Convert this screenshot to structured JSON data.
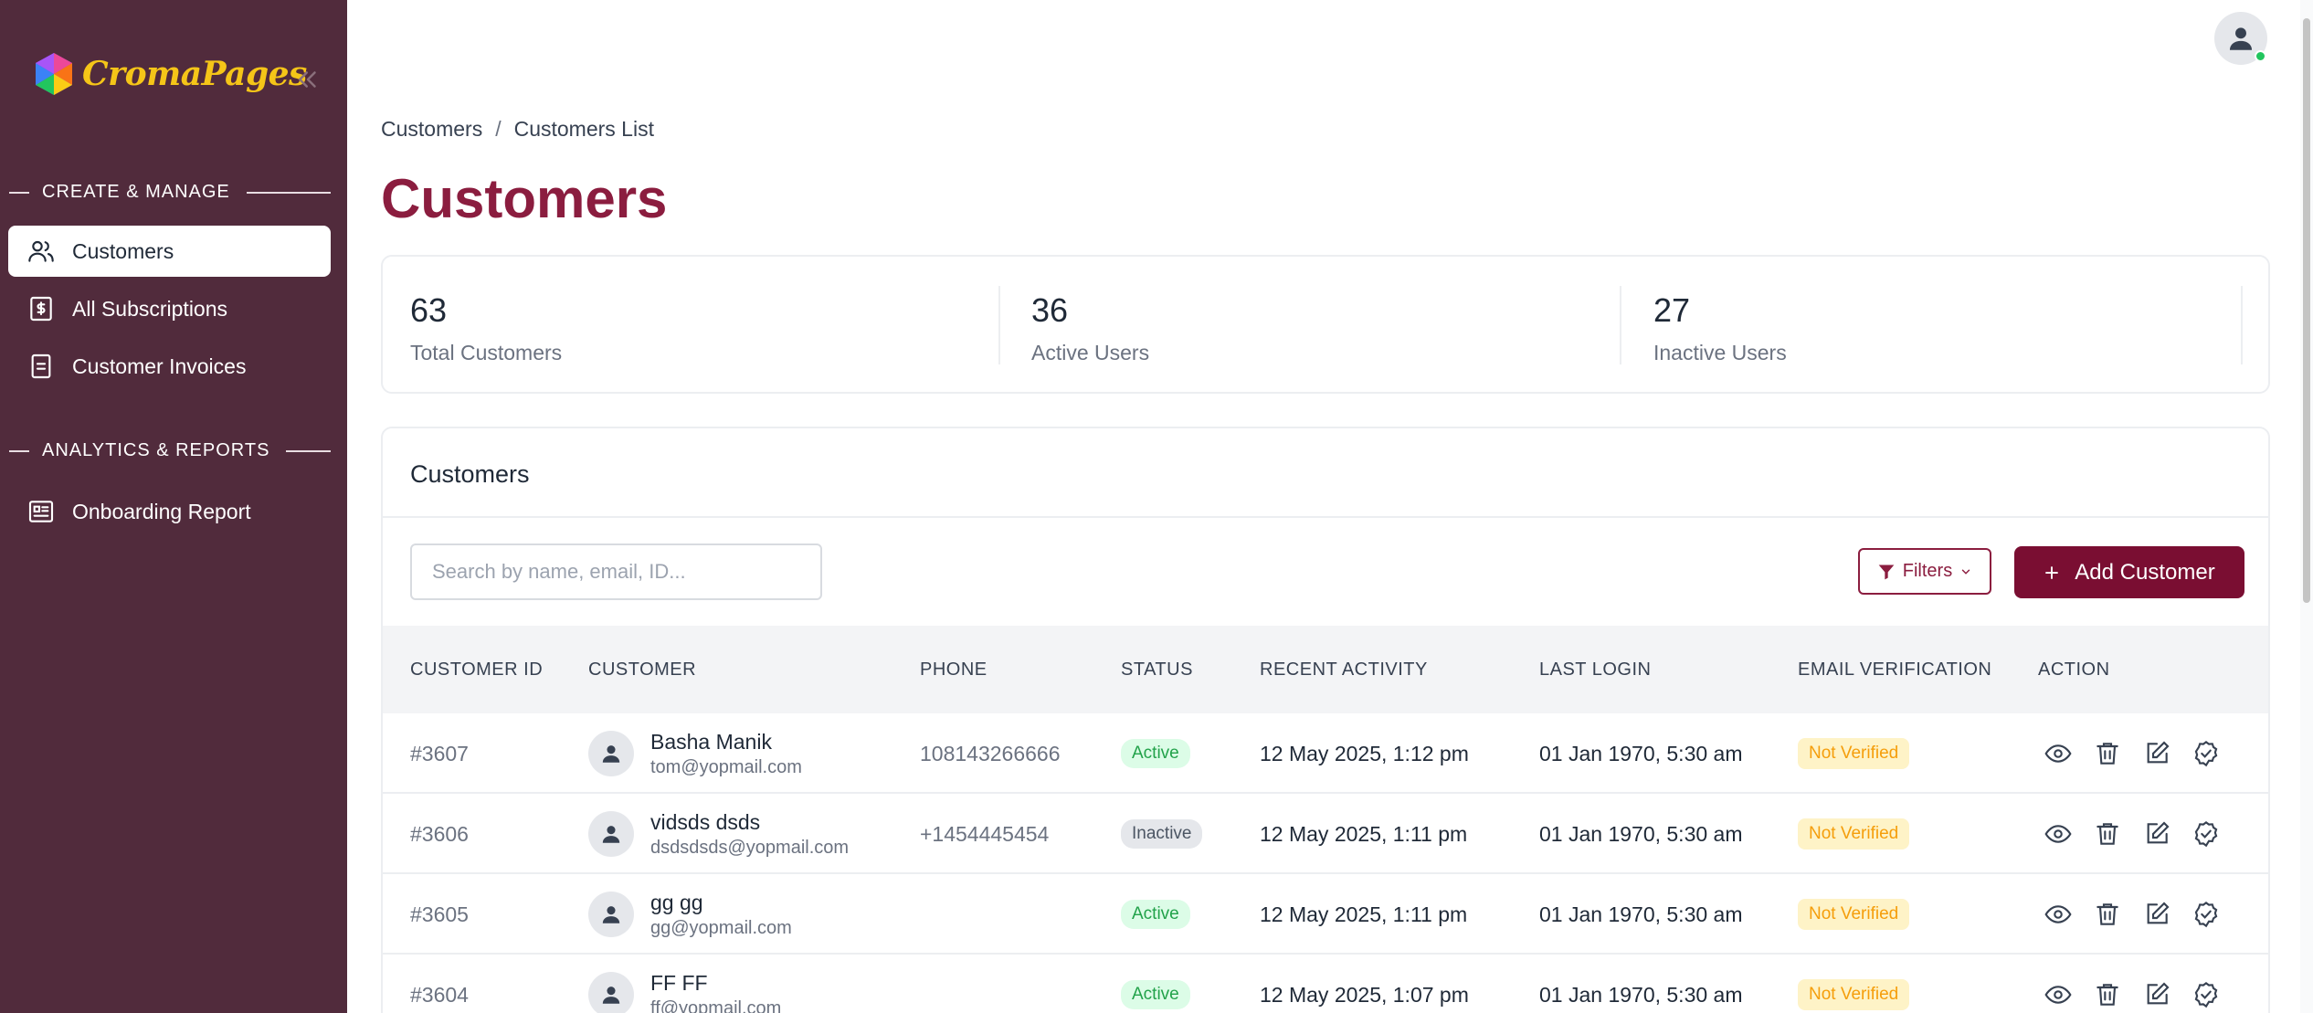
{
  "brand": {
    "name": "CromaPages"
  },
  "sidebar": {
    "sections": [
      {
        "label": "CREATE & MANAGE"
      },
      {
        "label": "ANALYTICS & REPORTS"
      }
    ],
    "items": [
      {
        "label": "Customers",
        "icon": "users-icon",
        "active": true
      },
      {
        "label": "All Subscriptions",
        "icon": "dollar-receipt-icon",
        "active": false
      },
      {
        "label": "Customer Invoices",
        "icon": "document-icon",
        "active": false
      },
      {
        "label": "Onboarding Report",
        "icon": "report-card-icon",
        "active": false
      }
    ]
  },
  "breadcrumb": {
    "parent": "Customers",
    "separator": "/",
    "current": "Customers List"
  },
  "page": {
    "title": "Customers"
  },
  "stats": [
    {
      "value": "63",
      "label": "Total Customers"
    },
    {
      "value": "36",
      "label": "Active Users"
    },
    {
      "value": "27",
      "label": "Inactive Users"
    }
  ],
  "table_card": {
    "title": "Customers",
    "search_placeholder": "Search by name, email, ID...",
    "filters_label": "Filters",
    "add_label": "Add Customer",
    "columns": [
      "CUSTOMER ID",
      "CUSTOMER",
      "PHONE",
      "STATUS",
      "RECENT ACTIVITY",
      "LAST LOGIN",
      "EMAIL VERIFICATION",
      "ACTION"
    ],
    "rows": [
      {
        "id": "#3607",
        "name": "Basha Manik",
        "email": "tom@yopmail.com",
        "phone": "108143266666",
        "status": "Active",
        "recent": "12 May 2025, 1:12 pm",
        "last_login": "01 Jan 1970, 5:30 am",
        "verification": "Not Verified"
      },
      {
        "id": "#3606",
        "name": "vidsds dsds",
        "email": "dsdsdsds@yopmail.com",
        "phone": "+1454445454",
        "status": "Inactive",
        "recent": "12 May 2025, 1:11 pm",
        "last_login": "01 Jan 1970, 5:30 am",
        "verification": "Not Verified"
      },
      {
        "id": "#3605",
        "name": "gg gg",
        "email": "gg@yopmail.com",
        "phone": "",
        "status": "Active",
        "recent": "12 May 2025, 1:11 pm",
        "last_login": "01 Jan 1970, 5:30 am",
        "verification": "Not Verified"
      },
      {
        "id": "#3604",
        "name": "FF FF",
        "email": "ff@yopmail.com",
        "phone": "",
        "status": "Active",
        "recent": "12 May 2025, 1:07 pm",
        "last_login": "01 Jan 1970, 5:30 am",
        "verification": "Not Verified"
      }
    ]
  },
  "colors": {
    "sidebar": "#512b3c",
    "accent": "#8b1d3f",
    "primary_button": "#7a0e32",
    "active_green": "#22a24a",
    "warning": "#f59e0b"
  }
}
